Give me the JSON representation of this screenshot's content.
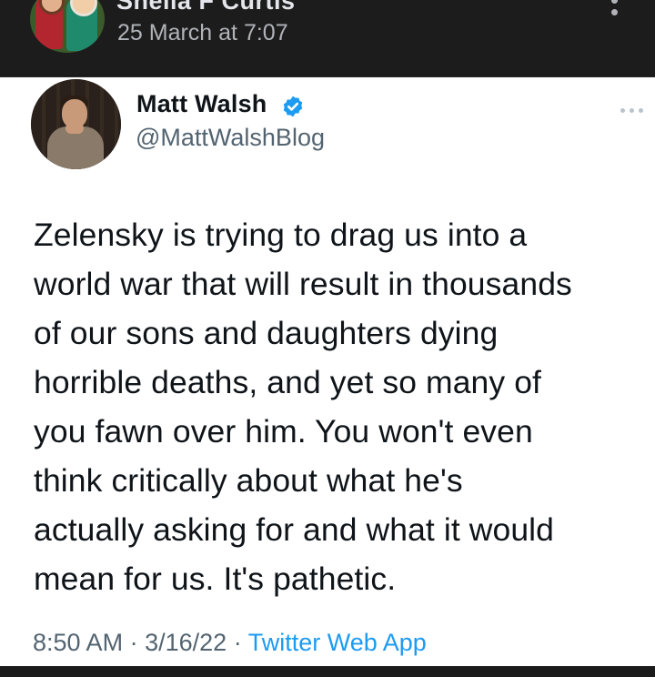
{
  "post": {
    "author_name": "Sheila F Curtis",
    "timestamp": "25 March at 7:07",
    "menu_icon": "vertical-dots-icon"
  },
  "tweet": {
    "display_name": "Matt Walsh",
    "handle": "@MattWalshBlog",
    "verified_icon": "verified-badge-icon",
    "more_icon": "more-dots-icon",
    "text_lines": [
      "Zelensky is trying to drag us into a",
      "world war that will result in thousands",
      "of our sons and daughters dying",
      "horrible deaths, and yet so many of",
      "you fawn over him. You won't even",
      "think critically about what he's",
      "actually asking for and what it would",
      "mean for us. It's pathetic."
    ],
    "time": "8:50 AM",
    "separator": "·",
    "date": "3/16/22",
    "source": "Twitter Web App"
  },
  "colors": {
    "link": "#1d9bf0",
    "verified": "#1d9bf0",
    "text": "#0f1419",
    "secondary": "#536471"
  }
}
